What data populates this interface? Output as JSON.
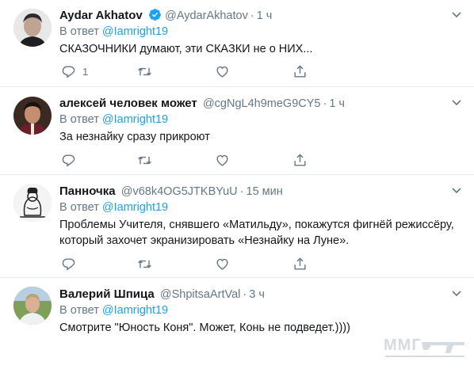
{
  "reply_prefix": "В ответ",
  "tweets": [
    {
      "name": "Aydar Akhatov",
      "verified": true,
      "handle": "@AydarAkhatov",
      "dot": "·",
      "time": "1 ч",
      "reply_to": "@Iamright19",
      "text": [
        "СКАЗОЧНИКИ думают, эти СКАЗКИ не о НИХ..."
      ],
      "reply_count": "1",
      "retweet_count": "",
      "like_count": ""
    },
    {
      "name": "алексей человек может",
      "verified": false,
      "handle": "@cgNgL4h9meG9CY5",
      "dot": "·",
      "time": "1 ч",
      "reply_to": "@Iamright19",
      "text": [
        "За незнайку сразу прикроют"
      ],
      "reply_count": "",
      "retweet_count": "",
      "like_count": ""
    },
    {
      "name": "Панночка",
      "verified": false,
      "handle": "@v68k4OG5JTKBYuU",
      "dot": "·",
      "time": "15 мин",
      "reply_to": "@Iamright19",
      "text": [
        "Проблемы Учителя, снявшего «Матильду», покажутся фигнёй режиссёру,",
        "который захочет экранизировать «Незнайку на Луне»."
      ],
      "reply_count": "",
      "retweet_count": "",
      "like_count": ""
    },
    {
      "name": "Валерий Шпица",
      "verified": false,
      "handle": "@ShpitsaArtVal",
      "dot": "·",
      "time": "3 ч",
      "reply_to": "@Iamright19",
      "text": [
        "Смотрите \"Юность Коня\". Может, Конь не подведет.))))"
      ],
      "reply_count": "",
      "retweet_count": "",
      "like_count": ""
    }
  ],
  "icons": {
    "reply": "reply-icon",
    "retweet": "retweet-icon",
    "like": "heart-icon",
    "share": "share-icon",
    "caret": "chevron-down-icon",
    "verified": "verified-badge-icon"
  },
  "watermark": {
    "text": "ММГ"
  },
  "colors": {
    "link": "#1da1f2",
    "secondary": "#657786",
    "divider": "#e6ecf0",
    "text": "#14171a"
  }
}
